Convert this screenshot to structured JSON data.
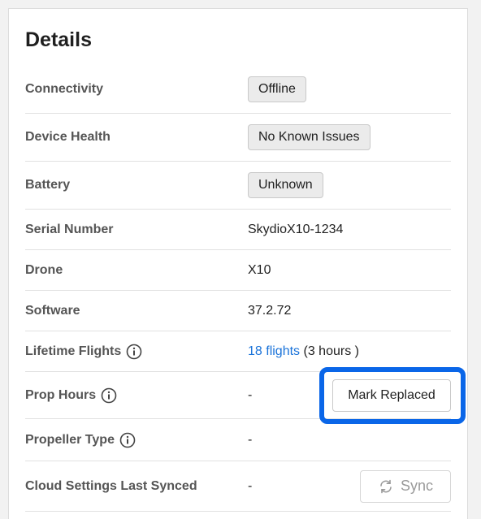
{
  "panel": {
    "title": "Details"
  },
  "rows": {
    "connectivity": {
      "label": "Connectivity",
      "value": "Offline"
    },
    "device_health": {
      "label": "Device Health",
      "value": "No Known Issues"
    },
    "battery": {
      "label": "Battery",
      "value": "Unknown"
    },
    "serial_number": {
      "label": "Serial Number",
      "value": "SkydioX10-1234"
    },
    "drone": {
      "label": "Drone",
      "value": "X10"
    },
    "software": {
      "label": "Software",
      "value": "37.2.72"
    },
    "lifetime_flights": {
      "label": "Lifetime Flights",
      "link": "18 flights",
      "suffix": "(3 hours )"
    },
    "prop_hours": {
      "label": "Prop Hours",
      "value": "-",
      "button": "Mark Replaced"
    },
    "propeller_type": {
      "label": "Propeller Type",
      "value": "-"
    },
    "cloud_settings": {
      "label": "Cloud Settings Last Synced",
      "value": "-",
      "button": "Sync"
    }
  },
  "icons": {
    "info": "info-icon",
    "sync": "sync-icon"
  },
  "colors": {
    "link": "#1a73d9",
    "highlight": "#0a66e8",
    "label": "#555555"
  }
}
